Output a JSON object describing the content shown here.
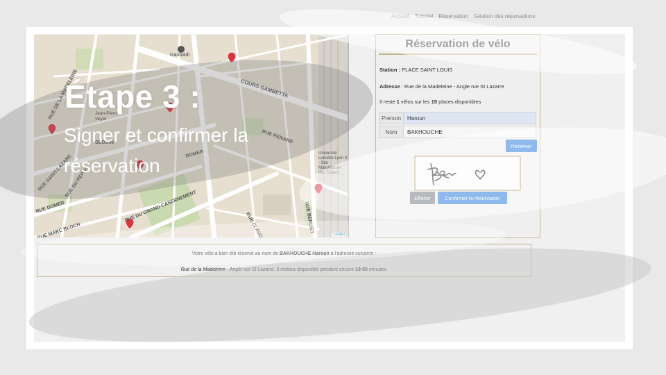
{
  "nav": {
    "items": [
      "Accueil",
      "Tutoriel",
      "Réservation",
      "Gestion des réservations"
    ]
  },
  "map": {
    "labels": {
      "garibaldi": "Garibaldi",
      "cours_gambetta": "COURS GAMBETTA",
      "madeleine": "RUE DE LA MADELEINE",
      "saint_lazare": "RUE SAINT-LAZARE",
      "du_repos": "RUE DU REPOS",
      "domer": "RUE DOMER",
      "marc_bloch": "RUE MARC BLOCH",
      "grand_casernement": "RUE DU GRAND CASERNEMENT",
      "claude_veyron": "RUE CLAUDE VEYRON",
      "berliet": "RUE BERLIET",
      "universite": "Université Lumière Lyon 3 - Site Manufacture des Tabacs",
      "leaflet": "Leaflet",
      "jean_pierre": "Jean-Pierre Veyet",
      "seguin": "SEGUIN",
      "renard": "RUE RENARD",
      "domer2": "DOMER"
    }
  },
  "panel": {
    "title": "Réservation de vélo",
    "station_label": "Station :",
    "station_value": "PLACE SAINT LOUIS",
    "adresse_label": "Adresse",
    "adresse_value": ": Rue de la Madeleine - Angle rue St Lazarre",
    "reste_prefix": "Il reste",
    "reste_count": "1",
    "reste_middle": "vélos sur les",
    "reste_total": "15",
    "reste_suffix": "places disponibles",
    "prenom_label": "Prenom",
    "prenom_value": "Haroun",
    "nom_label": "Nom",
    "nom_value": "BAKHOUCHE",
    "reserver_button": "Reserver",
    "effacer_button": "Effacer",
    "confirmer_button": "Confirmer la réservation"
  },
  "banner": {
    "line1_prefix": "Votre vélo a bien été réservé au nom de",
    "line1_name": "BAKHOUCHE Haroun",
    "line1_suffix": "à l'adresse suivante :",
    "line2_address": "Rue de la Madeleine - Angle rue St Lazarre",
    "line2_middle": ". Il restera disponible pendant encore",
    "line2_time": "19:50",
    "line2_suffix": "minutes."
  },
  "overlay": {
    "title": "Étape 3 :",
    "subtitle": "Signer et confirmer la réservation"
  },
  "colors": {
    "accent": "#1b73d8",
    "gold_border": "#c6b389",
    "secondary": "#6c757d",
    "marker": "#d9363e"
  }
}
